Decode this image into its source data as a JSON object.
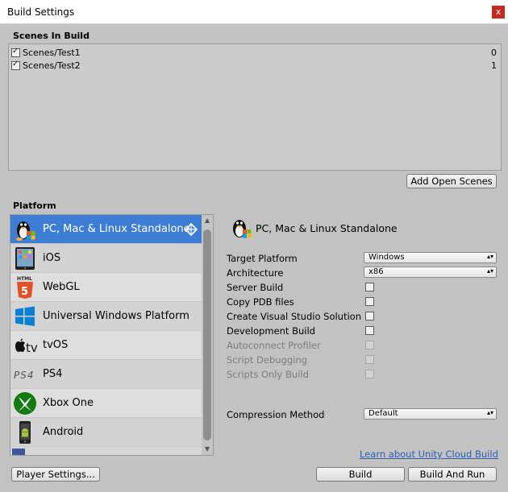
{
  "window": {
    "title": "Build Settings",
    "close_label": "x"
  },
  "scenes": {
    "title": "Scenes In Build",
    "items": [
      {
        "name": "Scenes/Test1",
        "index": "0",
        "checked": true
      },
      {
        "name": "Scenes/Test2",
        "index": "1",
        "checked": true
      }
    ],
    "add_open_scenes_label": "Add Open Scenes"
  },
  "platform": {
    "title": "Platform",
    "items": [
      {
        "label": "PC, Mac & Linux Standalone",
        "icon": "linux-penguin-icon",
        "selected": true
      },
      {
        "label": "iOS",
        "icon": "ipad-icon"
      },
      {
        "label": "WebGL",
        "icon": "html5-icon"
      },
      {
        "label": "Universal Windows Platform",
        "icon": "windows-icon"
      },
      {
        "label": "tvOS",
        "icon": "apple-tv-icon"
      },
      {
        "label": "PS4",
        "icon": "ps4-icon"
      },
      {
        "label": "Xbox One",
        "icon": "xbox-icon"
      },
      {
        "label": "Android",
        "icon": "android-icon"
      }
    ]
  },
  "settings": {
    "header": "PC, Mac & Linux Standalone",
    "target_platform": {
      "label": "Target Platform",
      "value": "Windows"
    },
    "architecture": {
      "label": "Architecture",
      "value": "x86"
    },
    "server_build": "Server Build",
    "copy_pdb": "Copy PDB files",
    "create_vs": "Create Visual Studio Solution",
    "development_build": "Development Build",
    "autoconnect_profiler": "Autoconnect Profiler",
    "script_debugging": "Script Debugging",
    "scripts_only": "Scripts Only Build",
    "compression": {
      "label": "Compression Method",
      "value": "Default"
    }
  },
  "footer": {
    "cloud_link": "Learn about Unity Cloud Build",
    "player_settings": "Player Settings...",
    "build": "Build",
    "build_and_run": "Build And Run",
    "ps4_text": "PS4",
    "tv_text": "tv",
    "html_text": "HTML"
  },
  "colors": {
    "selection": "#3e7dd6",
    "window_bg": "#c2c2c2",
    "link": "#2c5fb3"
  }
}
